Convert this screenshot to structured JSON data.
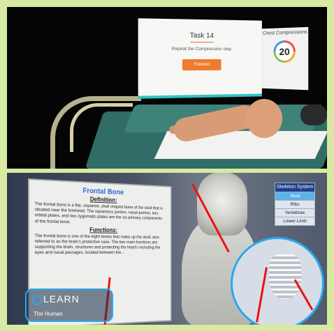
{
  "top_scene": {
    "task_card": {
      "title": "Task 14",
      "instruction": "Repeat the Compression step",
      "button_label": "Finished"
    },
    "compressions_card": {
      "title": "Chest Compressions",
      "count": "20"
    }
  },
  "bottom_scene": {
    "board": {
      "title": "Frontal Bone",
      "definition_heading": "Definition:",
      "definition_text": "The frontal bone is a flat, unpaired, shell shaped bone of the skull that is situated near the forehead. The squamous portion, nasal portion, two orbital plates, and two zygomatic plates are the six primary components of the frontal bone.",
      "functions_heading": "Functions:",
      "functions_text": "The frontal bone is one of the eight bones that make up the skull, also referred to as the brain's protective case. The two main functions are supporting the brain, structures and protecting the head's including the eyes and nasal passages, located between the..."
    },
    "skeleton_panel": {
      "title": "Skeleton System",
      "items": [
        "Skull",
        "Ribs",
        "Vertebrae",
        "Lower Limb"
      ],
      "active_index": 0
    },
    "learn_badge": {
      "title": "LEARN",
      "subtitle": "The Human"
    }
  },
  "colors": {
    "accent_orange": "#ef7b2d",
    "accent_teal": "#2ec4c4",
    "accent_blue": "#2aa7ee",
    "frame_green": "#d8eaa2"
  }
}
